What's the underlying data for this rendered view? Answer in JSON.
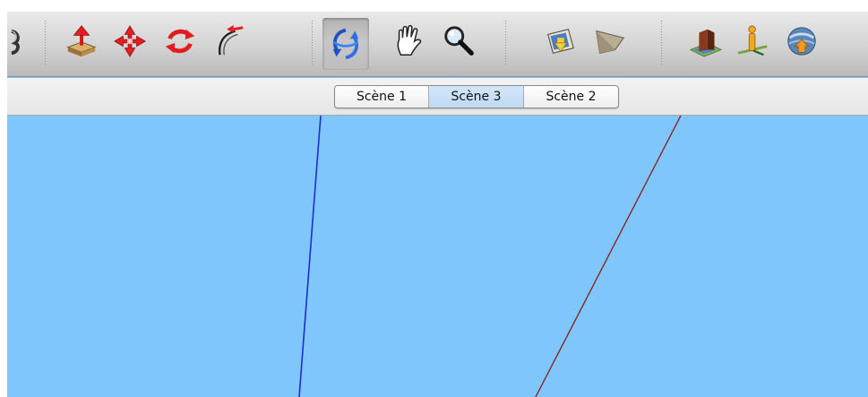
{
  "toolbar": {
    "tools": [
      {
        "icon": "paint-bucket-icon",
        "active": false
      },
      {
        "icon": "push-pull-icon",
        "active": false
      },
      {
        "icon": "move-icon",
        "active": false
      },
      {
        "icon": "rotate-icon",
        "active": false
      },
      {
        "icon": "follow-me-icon",
        "active": false
      },
      {
        "icon": "orbit-icon",
        "active": true
      },
      {
        "icon": "pan-hand-icon",
        "active": false
      },
      {
        "icon": "zoom-magnifier-icon",
        "active": false
      },
      {
        "icon": "get-models-icon",
        "active": false
      },
      {
        "icon": "share-model-icon",
        "active": false
      },
      {
        "icon": "building-maker-icon",
        "active": false
      },
      {
        "icon": "add-location-icon",
        "active": false
      },
      {
        "icon": "google-earth-icon",
        "active": false
      }
    ]
  },
  "scenes": {
    "tabs": [
      "Scène 1",
      "Scène 3",
      "Scène 2"
    ],
    "selected": "Scène 3"
  },
  "colors": {
    "sky": "#7ec6fb",
    "blue_axis": "#1b2fd0",
    "red_axis": "#8a1b1b"
  }
}
